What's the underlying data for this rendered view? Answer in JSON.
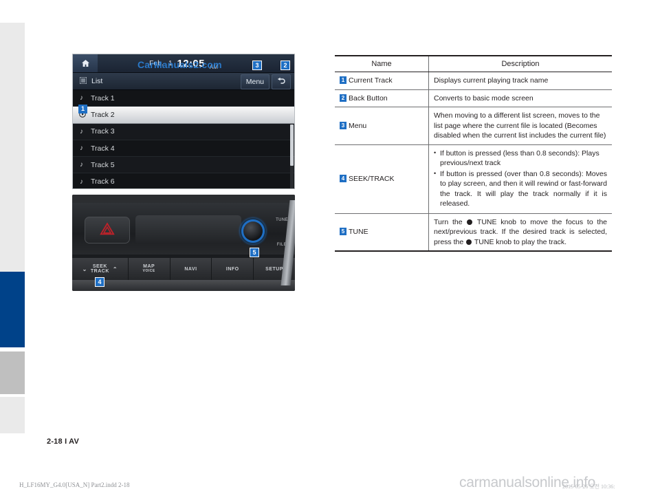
{
  "page": {
    "number_label": "2-18 I AV",
    "doc_footer": "H_LF16MY_G4.0[USA_N] Part2.indd   2-18",
    "date_stamp": "2015-05-26   오전 10:36:",
    "site_watermark": "carmanualsonline.info",
    "image_watermark": "CarManuals2.com",
    "accent_blue": "#1f6fc4",
    "sidebar_blue": "#004289",
    "sidebar_gray": "#bfbfbf",
    "sidebar_light": "#eaeaea"
  },
  "headunit": {
    "home_icon": "home-icon",
    "date": "Feb.",
    "day": "1",
    "time": "12:05",
    "ampm": "AM",
    "list_icon": "list-icon",
    "list_label": "List",
    "menu_label": "Menu",
    "back_icon": "back-arrow-icon",
    "tracks": [
      {
        "label": "Track 1",
        "icon": "music-note-icon",
        "selected": false
      },
      {
        "label": "Track 2",
        "icon": "play-circle-icon",
        "selected": true
      },
      {
        "label": "Track 3",
        "icon": "music-note-icon",
        "selected": false
      },
      {
        "label": "Track 4",
        "icon": "music-note-icon",
        "selected": false
      },
      {
        "label": "Track 5",
        "icon": "music-note-icon",
        "selected": false
      },
      {
        "label": "Track 6",
        "icon": "music-note-icon",
        "selected": false
      }
    ],
    "callouts": {
      "current_track": "1",
      "back_button": "2",
      "menu": "3"
    }
  },
  "dashboard": {
    "hazard_icon": "hazard-triangle-icon",
    "tune_label": "TUNE",
    "file_label": "FILE",
    "buttons": [
      {
        "label": "SEEK",
        "sublabel": "TRACK",
        "type": "seek"
      },
      {
        "label": "MAP",
        "sublabel": "VOICE",
        "type": "plain"
      },
      {
        "label": "NAVI",
        "sublabel": "",
        "type": "plain"
      },
      {
        "label": "INFO",
        "sublabel": "",
        "type": "plain"
      },
      {
        "label": "SETUP",
        "sublabel": "",
        "type": "plain"
      }
    ],
    "callouts": {
      "seek_track": "4",
      "tune": "5"
    }
  },
  "table": {
    "headers": {
      "name": "Name",
      "description": "Description"
    },
    "rows": [
      {
        "num": "1",
        "name": "Current Track",
        "desc_type": "text",
        "desc": "Displays current playing track name"
      },
      {
        "num": "2",
        "name": "Back Button",
        "desc_type": "text",
        "desc": "Converts to basic mode screen"
      },
      {
        "num": "3",
        "name": "Menu",
        "desc_type": "text",
        "desc": "When moving to a different list screen, moves to the list page where the current file is located (Becomes disabled when the current list includes the current file)"
      },
      {
        "num": "4",
        "name": "SEEK/TRACK",
        "desc_type": "bullets",
        "bullets": [
          "If button is pressed (less than 0.8 seconds): Plays previous/next track",
          "If button is pressed (over than 0.8 seconds): Moves to play screen, and then it will rewind or fast-forward the track. It will play the track normally if it is released."
        ]
      },
      {
        "num": "5",
        "name": "TUNE",
        "desc_type": "knob",
        "knob_part1": "Turn the",
        "knob_part2": "TUNE knob to move the focus to the next/previous track. If the desired track is selected, press the",
        "knob_part3": "TUNE knob to play the track."
      }
    ]
  }
}
